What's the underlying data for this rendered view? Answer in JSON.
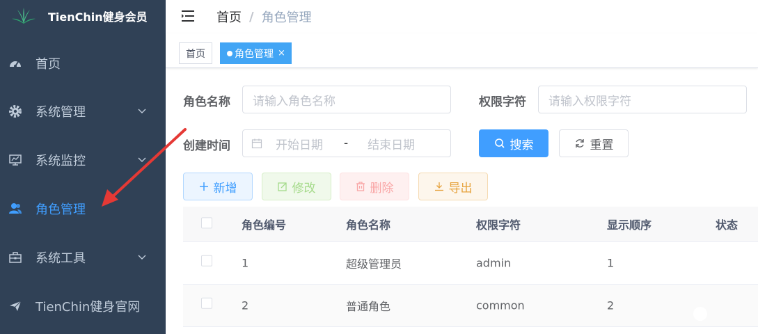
{
  "app": {
    "title": "TienChin健身会员"
  },
  "sidebar": {
    "items": [
      {
        "label": "首页",
        "icon": "dashboard-icon",
        "has_submenu": false,
        "active": false
      },
      {
        "label": "系统管理",
        "icon": "gear-icon",
        "has_submenu": true,
        "active": false
      },
      {
        "label": "系统监控",
        "icon": "monitor-icon",
        "has_submenu": true,
        "active": false
      },
      {
        "label": "角色管理",
        "icon": "users-icon",
        "has_submenu": false,
        "active": true
      },
      {
        "label": "系统工具",
        "icon": "toolbox-icon",
        "has_submenu": true,
        "active": false
      },
      {
        "label": "TienChin健身官网",
        "icon": "send-icon",
        "has_submenu": false,
        "active": false
      }
    ]
  },
  "breadcrumb": {
    "home": "首页",
    "separator": "/",
    "current": "角色管理"
  },
  "tags": [
    {
      "label": "首页",
      "active": false
    },
    {
      "label": "角色管理",
      "active": true,
      "close": "×"
    }
  ],
  "search": {
    "role_name_label": "角色名称",
    "role_name_placeholder": "请输入角色名称",
    "role_key_label": "权限字符",
    "role_key_placeholder": "请输入权限字符",
    "create_time_label": "创建时间",
    "start_placeholder": "开始日期",
    "range_sep": "-",
    "end_placeholder": "结束日期",
    "search_button": "搜索",
    "reset_button": "重置"
  },
  "toolbar": {
    "add": "新增",
    "edit": "修改",
    "delete": "删除",
    "export": "导出"
  },
  "table": {
    "headers": [
      "角色编号",
      "角色名称",
      "权限字符",
      "显示顺序",
      "状态"
    ],
    "rows": [
      {
        "id": "1",
        "name": "超级管理员",
        "key": "admin",
        "sort": "1",
        "status": true
      },
      {
        "id": "2",
        "name": "普通角色",
        "key": "common",
        "sort": "2",
        "status": true
      }
    ]
  },
  "colors": {
    "sidebar_bg": "#304156",
    "primary": "#409eff",
    "annotation_arrow": "#e53935"
  }
}
